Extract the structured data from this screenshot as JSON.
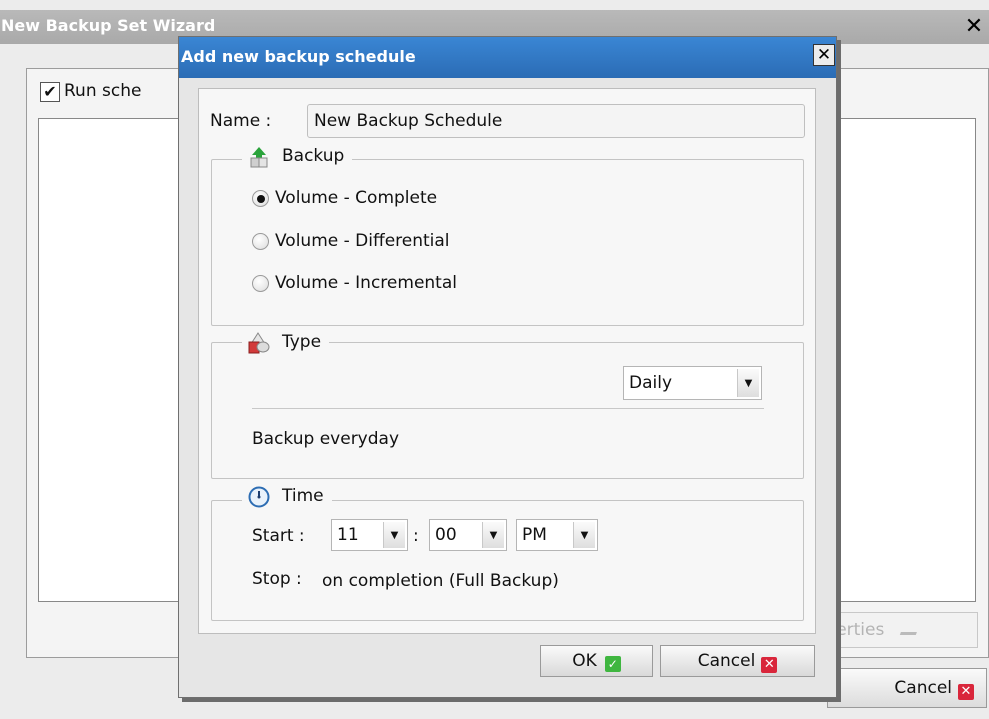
{
  "wizard": {
    "title": "New Backup Set Wizard",
    "run_schedule_label": "Run sche",
    "properties_label": "operties",
    "cancel_label": "Cancel"
  },
  "dialog": {
    "title": "Add new backup schedule",
    "name_label": "Name :",
    "name_value": "New Backup Schedule",
    "backup": {
      "legend": "Backup",
      "options": [
        {
          "label": "Volume - Complete",
          "selected": true
        },
        {
          "label": "Volume - Differential",
          "selected": false
        },
        {
          "label": "Volume - Incremental",
          "selected": false
        }
      ]
    },
    "type": {
      "legend": "Type",
      "selected": "Daily",
      "description": "Backup everyday"
    },
    "time": {
      "legend": "Time",
      "start_label": "Start :",
      "hour": "11",
      "separator": ":",
      "minute": "00",
      "ampm": "PM",
      "stop_label": "Stop :",
      "stop_value": "on completion (Full Backup)"
    },
    "ok_label": "OK",
    "cancel_label": "Cancel"
  },
  "icons": {
    "close": "close-icon",
    "backup": "backup-upload-icon",
    "type": "type-shapes-icon",
    "time": "clock-icon",
    "ok": "check-icon",
    "cancel": "x-icon"
  },
  "colors": {
    "dialog_titlebar": "#2f75c2",
    "wizard_titlebar": "#b0b0b0",
    "ok_check": "#3fb640",
    "cancel_x": "#d9263b"
  }
}
